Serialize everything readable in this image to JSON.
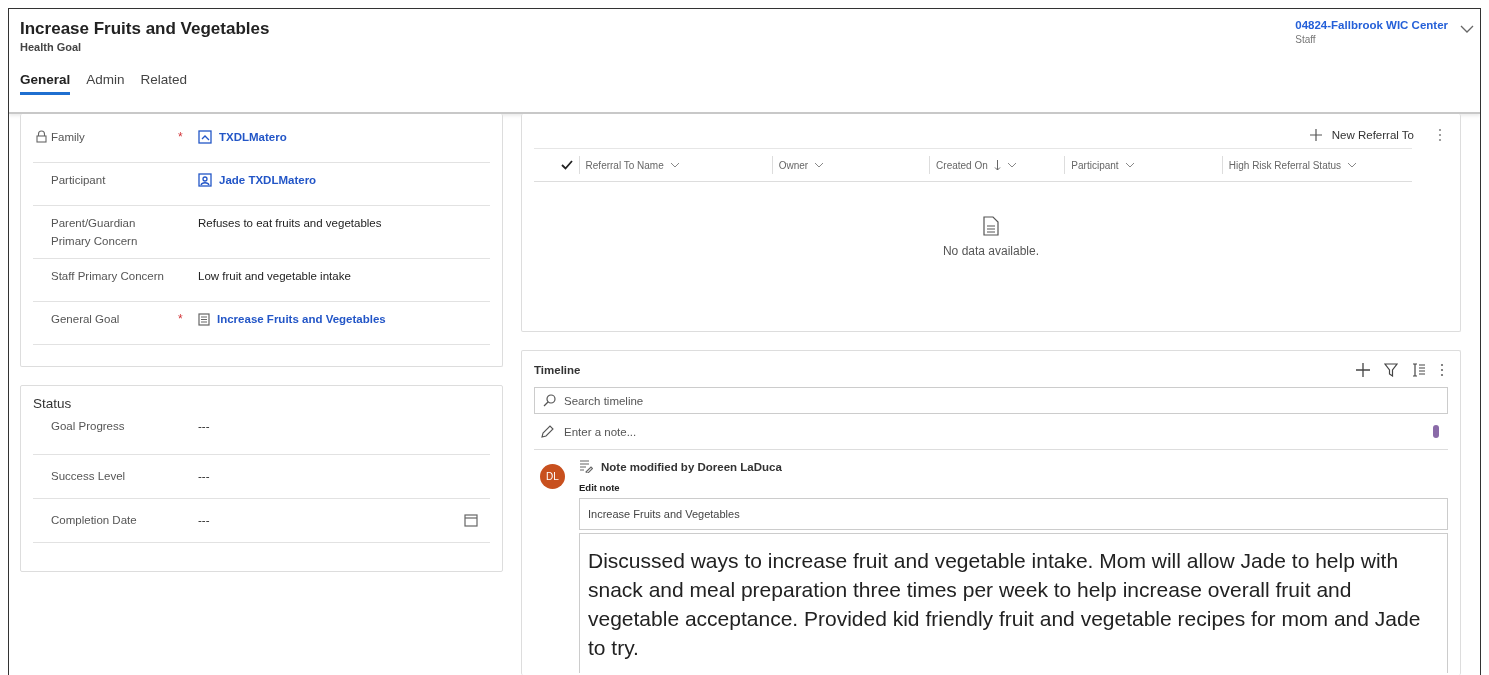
{
  "header": {
    "title": "Increase Fruits and Vegetables",
    "subtitle": "Health Goal",
    "owner": "04824-Fallbrook WIC Center",
    "owner_role": "Staff"
  },
  "tabs": [
    {
      "label": "General",
      "selected": true
    },
    {
      "label": "Admin",
      "selected": false
    },
    {
      "label": "Related",
      "selected": false
    }
  ],
  "form": {
    "rows": [
      {
        "label": "Family",
        "locked": true,
        "required_mark": "*",
        "kind": "link",
        "value": "TXDLMatero"
      },
      {
        "label": "Participant",
        "locked": false,
        "kind": "link",
        "value": "Jade TXDLMatero"
      },
      {
        "label": "Parent/Guardian Primary Concern",
        "locked": false,
        "kind": "text",
        "value": "Refuses to eat fruits and vegetables"
      },
      {
        "label": "Staff Primary Concern",
        "locked": false,
        "kind": "text",
        "value": "Low fruit and vegetable intake"
      },
      {
        "label": "General Goal",
        "locked": false,
        "required_mark": "*",
        "kind": "link",
        "value": "Increase Fruits and Vegetables"
      }
    ]
  },
  "status": {
    "title": "Status",
    "rows": [
      {
        "label": "Goal Progress",
        "kind": "text",
        "value": "---"
      },
      {
        "label": "Success Level",
        "kind": "text",
        "value": "---"
      },
      {
        "label": "Completion Date",
        "kind": "date",
        "value": "---"
      }
    ]
  },
  "referrals": {
    "command": "New Referral To",
    "columns": [
      {
        "label": "Referral To Name",
        "sorted": false
      },
      {
        "label": "Owner",
        "sorted": false
      },
      {
        "label": "Created On",
        "sorted": true
      },
      {
        "label": "Participant",
        "sorted": false
      },
      {
        "label": "High Risk Referral Status",
        "sorted": false
      }
    ],
    "empty_text": "No data available."
  },
  "timeline": {
    "title": "Timeline",
    "search_placeholder": "Search timeline",
    "note_placeholder": "Enter a note...",
    "entry": {
      "initials": "DL",
      "color": "#c8501e",
      "heading": "Note modified by Doreen LaDuca",
      "edit_label": "Edit note",
      "note_title": "Increase Fruits and Vegetables",
      "note_body": "Discussed ways to increase fruit and vegetable intake. Mom will allow Jade to help with snack and meal preparation three times per week to help increase overall fruit and vegetable acceptance. Provided kid friendly fruit and vegetable recipes for mom and Jade to try."
    }
  }
}
